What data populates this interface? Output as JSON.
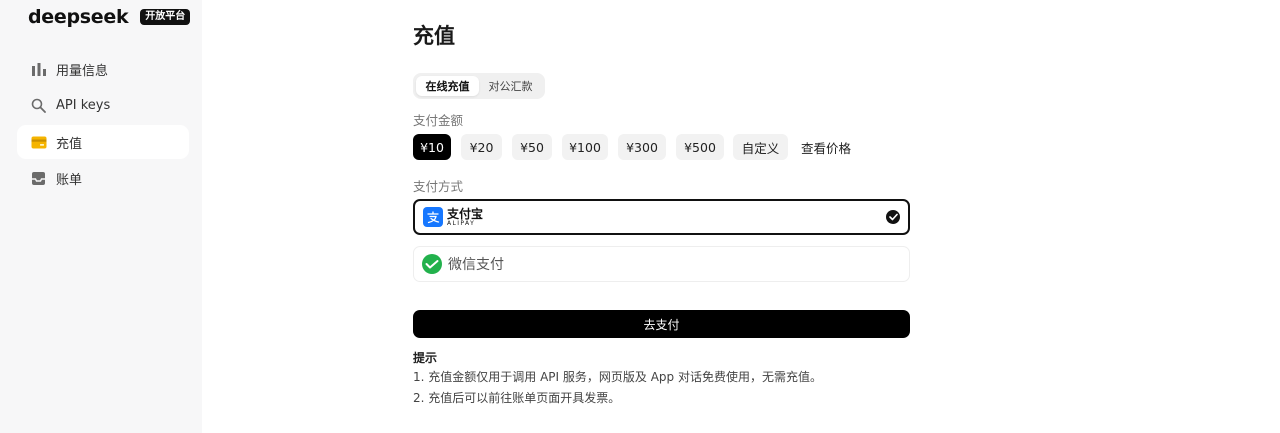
{
  "brand": {
    "name": "deepseek",
    "badge": "开放平台"
  },
  "sidebar": {
    "items": [
      {
        "label": "用量信息",
        "icon": "bar-chart-icon",
        "active": false
      },
      {
        "label": "API keys",
        "icon": "search-icon",
        "active": false
      },
      {
        "label": "充值",
        "icon": "card-icon",
        "active": true
      },
      {
        "label": "账单",
        "icon": "inbox-icon",
        "active": false
      }
    ]
  },
  "main": {
    "title": "充值",
    "tabs": [
      {
        "label": "在线充值",
        "active": true
      },
      {
        "label": "对公汇款",
        "active": false
      }
    ],
    "amount_label": "支付金额",
    "amounts": [
      {
        "label": "¥10",
        "selected": true
      },
      {
        "label": "¥20",
        "selected": false
      },
      {
        "label": "¥50",
        "selected": false
      },
      {
        "label": "¥100",
        "selected": false
      },
      {
        "label": "¥300",
        "selected": false
      },
      {
        "label": "¥500",
        "selected": false
      },
      {
        "label": "自定义",
        "selected": false
      }
    ],
    "view_price_link": "查看价格",
    "method_label": "支付方式",
    "methods": {
      "alipay": {
        "name_cn": "支付宝",
        "name_en": "ALIPAY",
        "selected": true
      },
      "wechat": {
        "name": "微信支付",
        "selected": false
      }
    },
    "pay_button": "去支付",
    "tips": {
      "title": "提示",
      "lines": [
        "1. 充值金额仅用于调用 API 服务，网页版及 App 对话免费使用，无需充值。",
        "2. 充值后可以前往账单页面开具发票。"
      ]
    }
  },
  "colors": {
    "accent": "#000000",
    "sidebar_bg": "#f7f7f8",
    "card_icon": "#f5b400",
    "alipay_blue": "#1677ff",
    "wechat_green": "#22b14c"
  }
}
